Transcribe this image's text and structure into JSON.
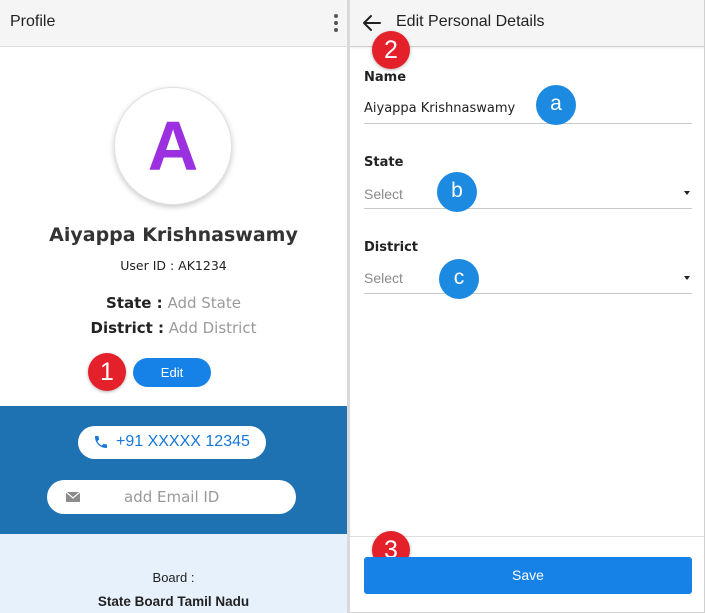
{
  "profile": {
    "header_title": "Profile",
    "avatar_letter": "A",
    "name": "Aiyappa Krishnaswamy",
    "user_id": "User ID : AK1234",
    "state_label": "State :",
    "state_value": "Add State",
    "district_label": "District :",
    "district_value": "Add District",
    "edit_label": "Edit",
    "phone": "+91 XXXXX 12345",
    "email_placeholder": "add Email ID",
    "board_label": "Board :",
    "board_value": "State Board Tamil Nadu",
    "icons": [
      "more-vertical-icon",
      "phone-icon",
      "mail-icon"
    ]
  },
  "edit_form": {
    "header_title": "Edit Personal Details",
    "name_label": "Name",
    "name_value": "Aiyappa Krishnaswamy",
    "state_label": "State",
    "state_placeholder": "Select",
    "district_label": "District",
    "district_placeholder": "Select",
    "save_label": "Save",
    "icons": [
      "back-arrow-icon",
      "dropdown-caret-icon"
    ]
  },
  "annotations": {
    "step_1": "1",
    "step_2": "2",
    "step_3": "3",
    "field_a": "a",
    "field_b": "b",
    "field_c": "c"
  },
  "colors": {
    "accent_blue": "#1682e8",
    "section_blue": "#1e72b2",
    "light_blue": "#e6f1fc",
    "avatar_purple": "#9b30e0",
    "marker_red": "#e4212b",
    "marker_blue": "#1c8ae0"
  }
}
